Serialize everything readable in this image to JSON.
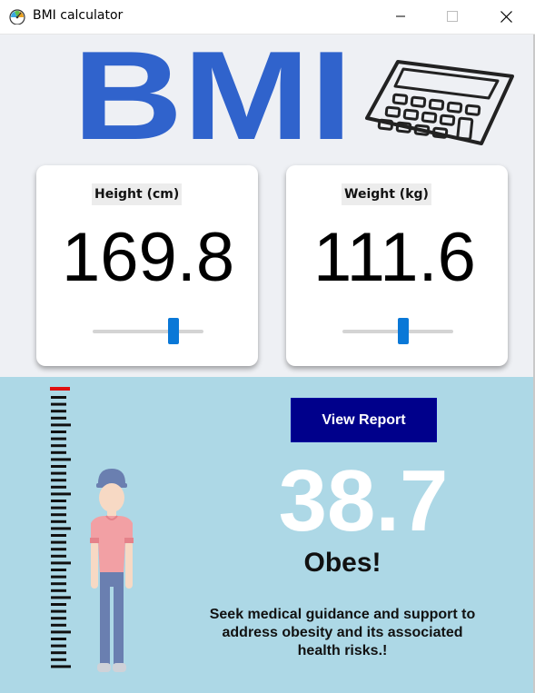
{
  "window": {
    "title": "BMI calculator"
  },
  "header": {
    "logo_text": "BMI",
    "logo_color": "#3063cc",
    "calculator_icon": "calculator-icon"
  },
  "height_card": {
    "label": "Height (cm)",
    "value": "169.8",
    "slider_fraction": 0.73
  },
  "weight_card": {
    "label": "Weight (kg)",
    "value": "111.6",
    "slider_fraction": 0.55
  },
  "result": {
    "report_button_label": "View Report",
    "bmi_value": "38.7",
    "category": "Obes!",
    "advice": "Seek medical guidance and support to address obesity and its associated health risks.!"
  },
  "colors": {
    "top_background": "#eef0f4",
    "bottom_background": "#add8e6",
    "button_background": "#00008b",
    "slider_accent": "#0a78d7",
    "ruler_marker": "#e01010"
  }
}
